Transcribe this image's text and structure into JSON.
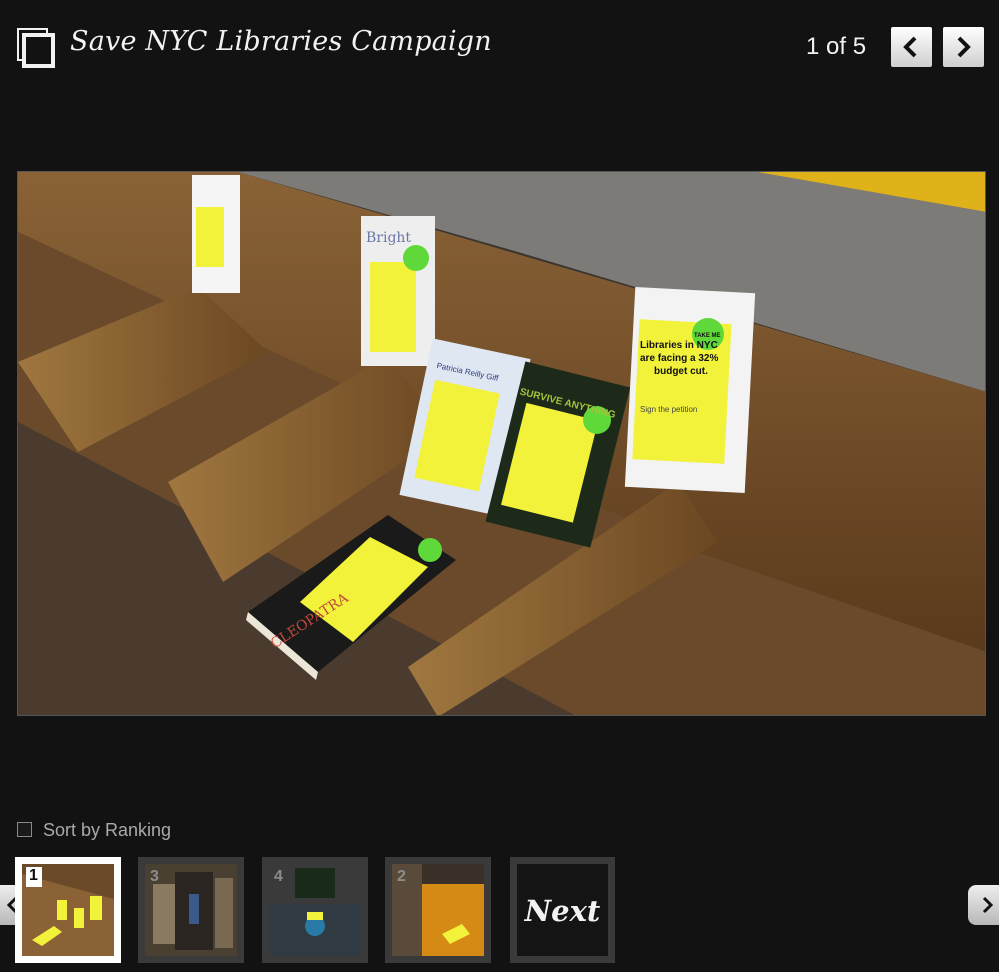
{
  "header": {
    "title": "Save NYC Libraries Campaign",
    "counter": "1 of 5",
    "icons": {
      "gallery": "gallery-icon",
      "prev": "chevron-left-icon",
      "next": "chevron-right-icon"
    }
  },
  "photo": {
    "book_flyer": {
      "line1": "Libraries in NYC",
      "line2": "are facing a 32%",
      "line3": "budget cut.",
      "badge": "TAKE ME",
      "sign": "Sign the petition"
    },
    "book_titles": [
      "Bright",
      "Patricia Reilly Giff",
      "SURVIVE ANYTHING",
      "CLEOPATRA"
    ]
  },
  "sort": {
    "label": "Sort by Ranking",
    "checked": false
  },
  "thumbnails": [
    {
      "number": "1",
      "selected": true
    },
    {
      "number": "3",
      "selected": false
    },
    {
      "number": "4",
      "selected": false
    },
    {
      "number": "2",
      "selected": false
    }
  ],
  "next_label": "Next",
  "colors": {
    "background": "#121212",
    "flyer_yellow": "#f2f23a",
    "badge_green": "#5fd83a"
  }
}
